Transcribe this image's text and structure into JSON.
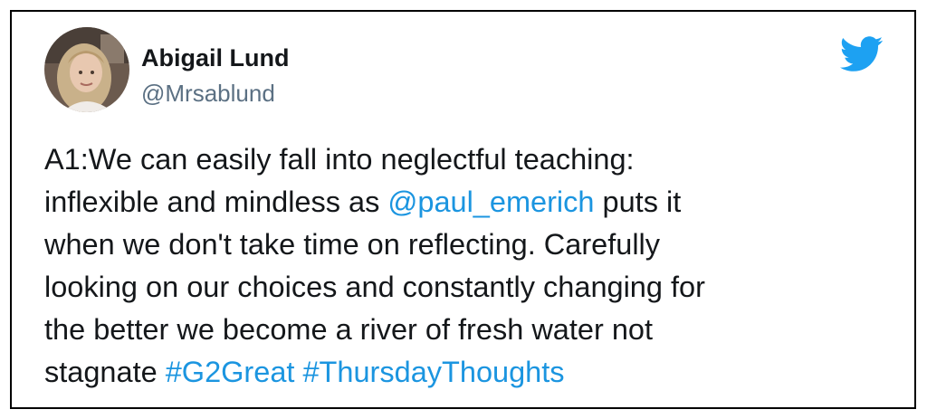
{
  "tweet": {
    "author": {
      "display_name": "Abigail Lund",
      "handle": "@Mrsablund"
    },
    "body": {
      "lines": [
        [
          {
            "type": "text",
            "value": "A1:We can easily fall into neglectful teaching:"
          }
        ],
        [
          {
            "type": "text",
            "value": "inflexible and mindless as "
          },
          {
            "type": "mention",
            "value": "@paul_emerich"
          },
          {
            "type": "text",
            "value": " puts it"
          }
        ],
        [
          {
            "type": "text",
            "value": "when we don't take time on reflecting. Carefully"
          }
        ],
        [
          {
            "type": "text",
            "value": "looking on our choices and constantly changing for"
          }
        ],
        [
          {
            "type": "text",
            "value": "the better we become a river of fresh water not"
          }
        ],
        [
          {
            "type": "text",
            "value": "stagnate "
          },
          {
            "type": "hashtag",
            "value": "#G2Great"
          },
          {
            "type": "text",
            "value": " "
          },
          {
            "type": "hashtag",
            "value": "#ThursdayThoughts"
          }
        ]
      ]
    },
    "icons": {
      "brand": "twitter-bird-icon",
      "avatar": "profile-photo"
    },
    "colors": {
      "link": "#1b95e0",
      "brand": "#1da1f2",
      "text": "#14171a",
      "secondary": "#5b7083",
      "border": "#000000"
    }
  }
}
